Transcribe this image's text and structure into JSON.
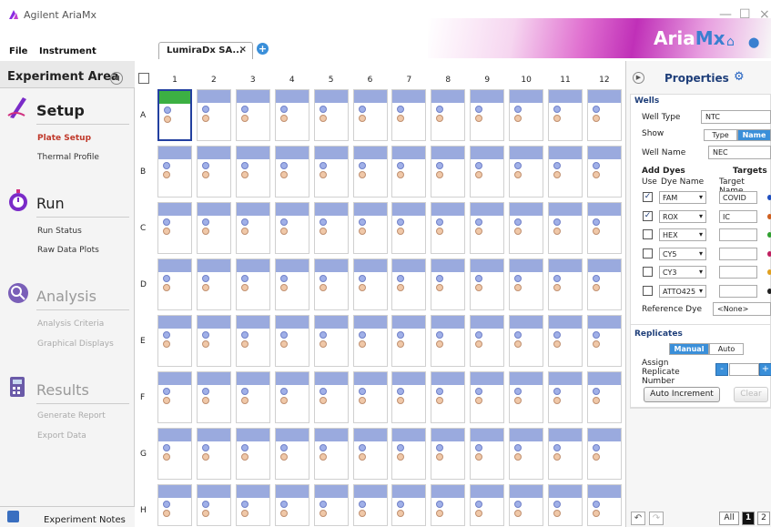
{
  "app": {
    "title": "Agilent AriaMx",
    "logo_aria": "Aria",
    "logo_mx": "Mx"
  },
  "menu": {
    "file": "File",
    "instrument": "Instrument"
  },
  "tab": {
    "label": "LumiraDx SA...",
    "close": "×",
    "add": "+"
  },
  "window": {
    "minimize": "—",
    "maximize": "☐",
    "close": "×"
  },
  "header_icons": {
    "home": "⌂",
    "pin": "⬤"
  },
  "left": {
    "title": "Experiment Area",
    "collapse": "◀",
    "setup": {
      "title": "Setup",
      "items": [
        "Plate Setup",
        "Thermal Profile"
      ]
    },
    "run": {
      "title": "Run",
      "items": [
        "Run Status",
        "Raw Data Plots"
      ]
    },
    "analysis": {
      "title": "Analysis",
      "items": [
        "Analysis Criteria",
        "Graphical Displays"
      ]
    },
    "results": {
      "title": "Results",
      "items": [
        "Generate Report",
        "Export Data"
      ]
    },
    "notes": "Experiment Notes"
  },
  "plate": {
    "columns": [
      "1",
      "2",
      "3",
      "4",
      "5",
      "6",
      "7",
      "8",
      "9",
      "10",
      "11",
      "12"
    ],
    "rows": [
      "A",
      "B",
      "C",
      "D",
      "E",
      "F",
      "G",
      "H"
    ],
    "selected_well": "A1"
  },
  "properties": {
    "title": "Properties",
    "toggle": "▶",
    "wells": {
      "section": "Wells",
      "well_type_label": "Well Type",
      "well_type": "NTC",
      "show_label": "Show",
      "show_options": [
        "Type",
        "Name"
      ],
      "show_selected": "Name",
      "well_name_label": "Well Name",
      "well_name": "NEC",
      "add_dyes": "Add Dyes",
      "targets": "Targets",
      "use_col": "Use",
      "dye_col": "Dye Name",
      "target_col": "Target Name",
      "dyes": [
        {
          "name": "FAM",
          "checked": true,
          "target": "COVID",
          "color": "#2050c0"
        },
        {
          "name": "ROX",
          "checked": true,
          "target": "IC",
          "color": "#d06020"
        },
        {
          "name": "HEX",
          "checked": false,
          "target": "",
          "color": "#30a030"
        },
        {
          "name": "CY5",
          "checked": false,
          "target": "",
          "color": "#c02060"
        },
        {
          "name": "CY3",
          "checked": false,
          "target": "",
          "color": "#e0a020"
        },
        {
          "name": "ATTO425",
          "checked": false,
          "target": "",
          "color": "#202020"
        }
      ],
      "ref_dye_label": "Reference Dye",
      "ref_dye": "<None>"
    },
    "replicates": {
      "section": "Replicates",
      "modes": [
        "Manual",
        "Auto"
      ],
      "selected": "Manual",
      "assign_label": "Assign Replicate Number",
      "auto_increment": "Auto Increment",
      "clear": "Clear"
    }
  },
  "footer": {
    "all": "All",
    "pages": [
      "1",
      "2"
    ],
    "selected_page": "1"
  }
}
